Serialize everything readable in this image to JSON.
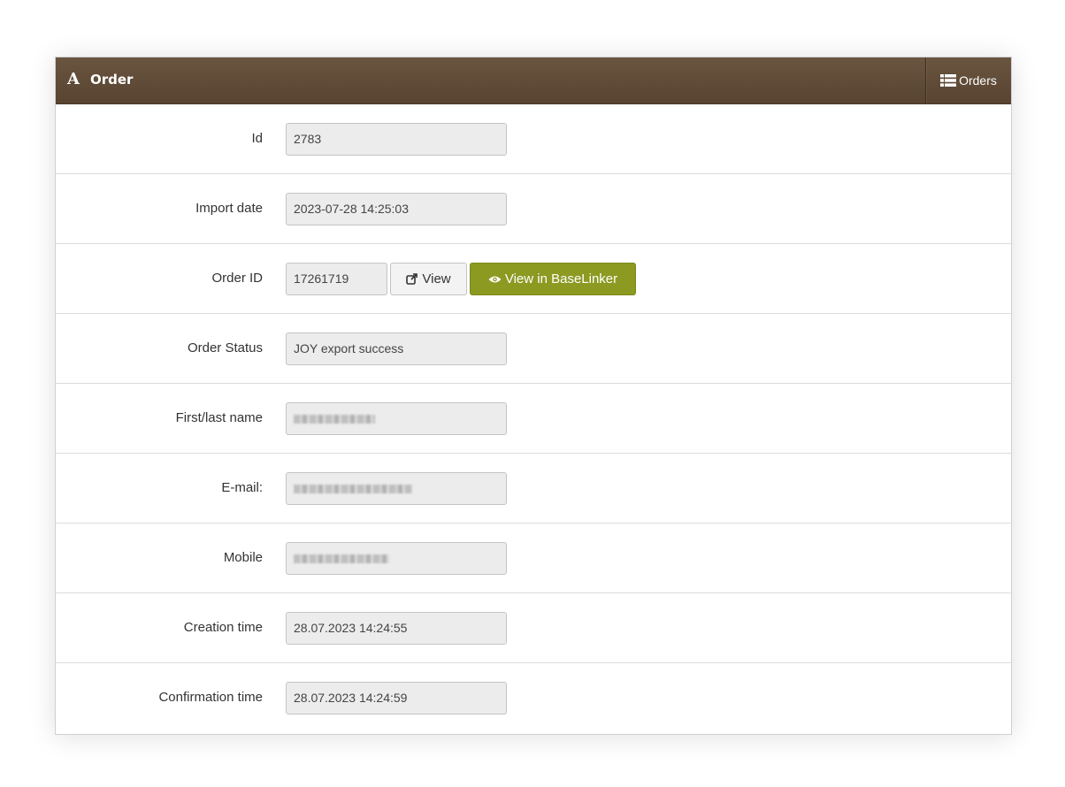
{
  "header": {
    "icon": "A",
    "title": "Order",
    "orders_button": "Orders"
  },
  "fields": {
    "id": {
      "label": "Id",
      "value": "2783"
    },
    "import_date": {
      "label": "Import date",
      "value": "2023-07-28 14:25:03"
    },
    "order_id": {
      "label": "Order ID",
      "value": "17261719",
      "view_button": "View",
      "baselinker_button": "View in BaseLinker"
    },
    "order_status": {
      "label": "Order Status",
      "value": "JOY export success"
    },
    "name": {
      "label": "First/last name"
    },
    "email": {
      "label": "E-mail:"
    },
    "mobile": {
      "label": "Mobile"
    },
    "creation_time": {
      "label": "Creation time",
      "value": "28.07.2023 14:24:55"
    },
    "confirmation_time": {
      "label": "Confirmation time",
      "value": "28.07.2023 14:24:59"
    }
  },
  "colors": {
    "header_bg": "#5f4a36",
    "baselinker_button": "#8c9a22",
    "input_bg": "#ececec"
  },
  "icons": {
    "header": "font-letter-icon",
    "orders": "list-icon",
    "view": "external-link-icon",
    "baselinker": "eye-icon"
  }
}
